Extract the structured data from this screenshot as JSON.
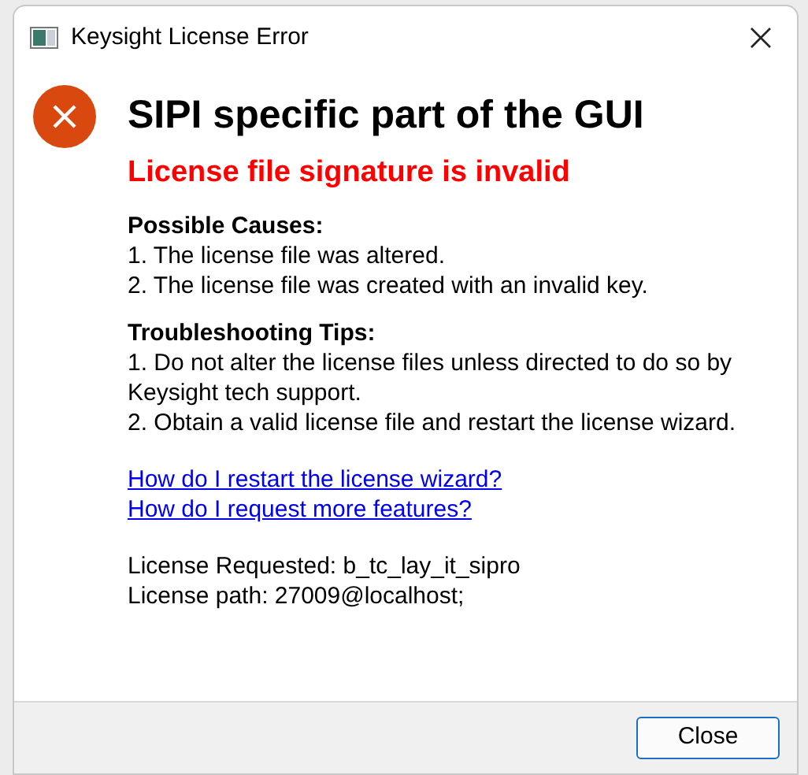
{
  "window": {
    "title": "Keysight License Error"
  },
  "heading": "SIPI specific part of the GUI",
  "error": "License file signature is invalid",
  "sections": [
    {
      "title": "Possible Causes:",
      "lines": [
        "1. The license file was altered.",
        "2. The license file was created with an invalid key."
      ]
    },
    {
      "title": "Troubleshooting Tips:",
      "lines": [
        "1. Do not alter the license files unless directed to do so by Keysight tech support.",
        "2. Obtain a valid license file and restart the license wizard."
      ]
    }
  ],
  "links": [
    "How do I restart the license wizard?",
    "How do I request more features?"
  ],
  "info": [
    "License Requested: b_tc_lay_it_sipro",
    "License path: 27009@localhost;"
  ],
  "buttons": [
    "Close"
  ]
}
